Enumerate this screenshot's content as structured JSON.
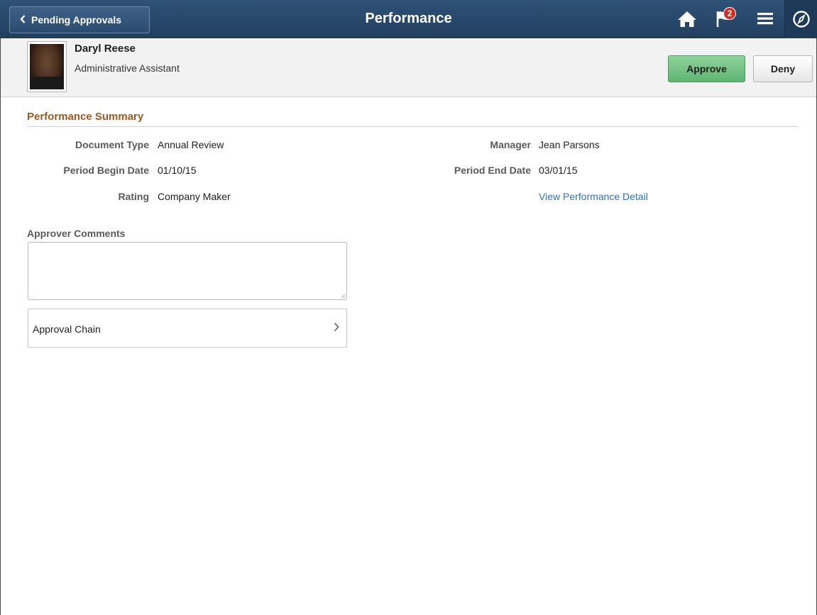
{
  "banner": {
    "back_label": "Pending Approvals",
    "title": "Performance",
    "notification_count": "2",
    "icons": [
      "chevron-left-icon",
      "home-icon",
      "flag-icon",
      "hamburger-menu-icon",
      "compass-icon"
    ],
    "colors": {
      "banner": "#2a4a6e",
      "badge": "#d52b1e"
    }
  },
  "employee": {
    "name": "Daryl Reese",
    "job_title": "Administrative Assistant"
  },
  "actions": {
    "approve_label": "Approve",
    "deny_label": "Deny",
    "colors": {
      "approve": "#6cbf7e"
    }
  },
  "summary": {
    "heading": "Performance Summary",
    "fields": {
      "document_type": {
        "label": "Document Type",
        "value": "Annual Review"
      },
      "period_begin": {
        "label": "Period Begin Date",
        "value": "01/10/15"
      },
      "rating": {
        "label": "Rating",
        "value": "Company Maker"
      },
      "manager": {
        "label": "Manager",
        "value": "Jean Parsons"
      },
      "period_end": {
        "label": "Period End Date",
        "value": "03/01/15"
      }
    },
    "detail_link": "View Performance Detail",
    "colors": {
      "heading": "#a6561d",
      "link": "#2d73c4"
    }
  },
  "comments": {
    "label": "Approver Comments",
    "value": ""
  },
  "approval_chain": {
    "label": "Approval Chain"
  }
}
